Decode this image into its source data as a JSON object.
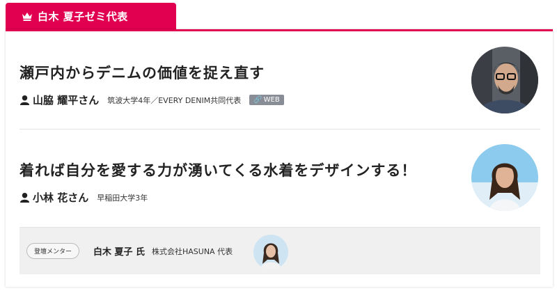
{
  "header": {
    "tab_label": "白木 夏子ゼミ代表",
    "icon": "crown-icon",
    "accent_color": "#e0004f"
  },
  "entries": [
    {
      "title": "瀬戸内からデニムの価値を捉え直す",
      "student_name": "山脇 耀平さん",
      "affiliation": "筑波大学4年／EVERY DENIM共同代表",
      "web_label": "WEB",
      "avatar": "student-photo-man-glasses"
    },
    {
      "title": "着れば自分を愛する力が湧いてくる水着をデザインする！",
      "student_name": "小林 花さん",
      "affiliation": "早稲田大学3年",
      "avatar": "student-photo-woman-beach"
    }
  ],
  "mentor": {
    "badge": "登壇メンター",
    "name": "白木 夏子 氏",
    "affiliation": "株式会社HASUNA 代表",
    "avatar": "mentor-photo-woman"
  }
}
